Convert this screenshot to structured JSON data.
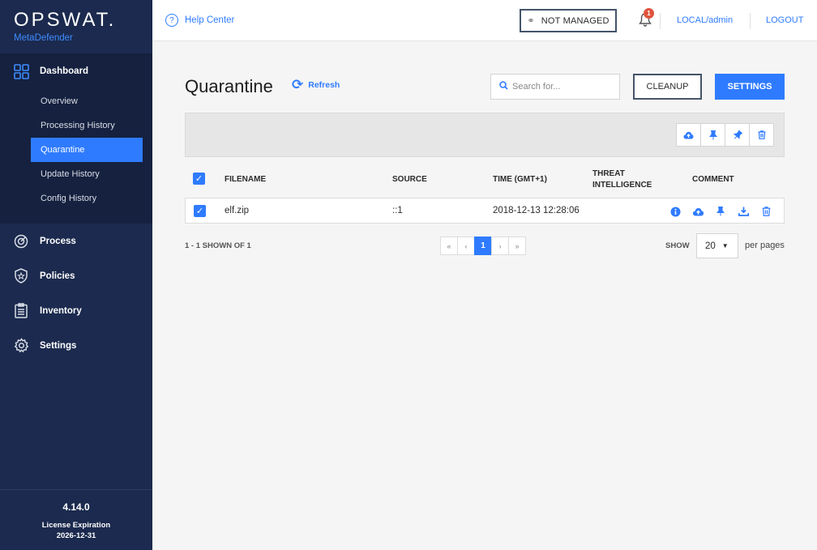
{
  "brand": {
    "logo": "OPSWAT.",
    "product": "MetaDefender"
  },
  "sidebar": {
    "dashboard": "Dashboard",
    "sub_items": [
      "Overview",
      "Processing History",
      "Quarantine",
      "Update History",
      "Config History"
    ],
    "items": [
      "Process",
      "Policies",
      "Inventory",
      "Settings"
    ],
    "version": "4.14.0",
    "license_label": "License Expiration",
    "license_date": "2026-12-31"
  },
  "topbar": {
    "help": "Help Center",
    "not_managed": "NOT MANAGED",
    "notif_count": "1",
    "user": "LOCAL/admin",
    "logout": "LOGOUT"
  },
  "page": {
    "title": "Quarantine",
    "refresh": "Refresh",
    "search_placeholder": "Search for...",
    "cleanup": "CLEANUP",
    "settings": "SETTINGS"
  },
  "table": {
    "headers": {
      "filename": "FILENAME",
      "source": "SOURCE",
      "time": "TIME (GMT+1)",
      "threat1": "THREAT",
      "threat2": "INTELLIGENCE",
      "comment": "COMMENT"
    },
    "rows": [
      {
        "filename": "elf.zip",
        "source": "::1",
        "time": "2018-12-13 12:28:06"
      }
    ]
  },
  "pagination": {
    "shown": "1 - 1 SHOWN OF 1",
    "first": "«",
    "prev": "‹",
    "current": "1",
    "next": "›",
    "last": "»",
    "show_label": "SHOW",
    "page_size": "20",
    "per_pages": "per pages"
  },
  "colors": {
    "accent": "#2f7bff",
    "sidebar": "#1b2a4e",
    "badge": "#e0533d"
  }
}
